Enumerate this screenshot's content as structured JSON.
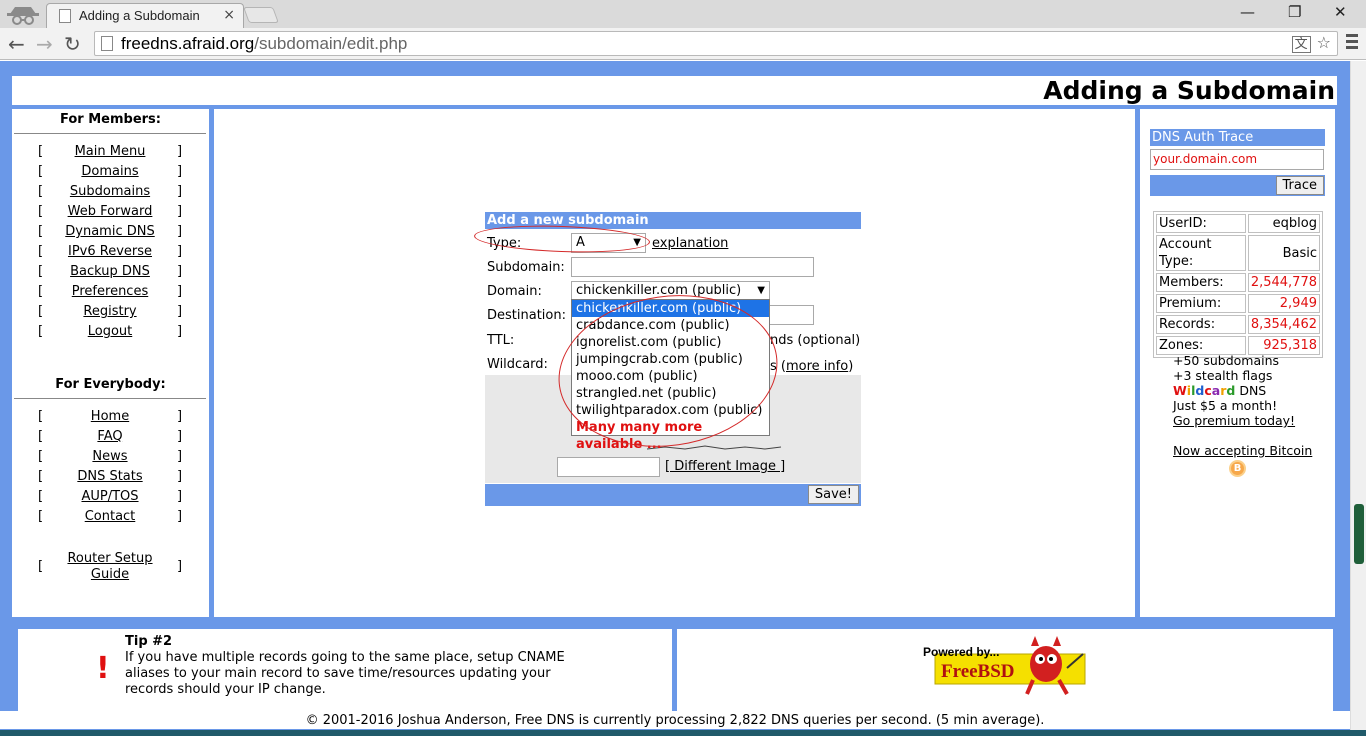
{
  "browser": {
    "tab_title": "Adding a Subdomain",
    "tab_close": "×",
    "url_host": "freedns.afraid.org",
    "url_path": "/subdomain/edit.php",
    "back": "←",
    "forward": "→",
    "reload": "↻",
    "minimize": "—",
    "restore": "❐",
    "close": "✕",
    "star": "☆",
    "translate": "文"
  },
  "page": {
    "title": "Adding a Subdomain"
  },
  "members": {
    "title": "For Members:",
    "items": [
      "Main Menu",
      "Domains",
      "Subdomains",
      "Web Forward",
      "Dynamic DNS",
      "IPv6 Reverse",
      "Backup DNS",
      "Preferences",
      "Registry",
      "Logout"
    ]
  },
  "everybody": {
    "title": "For Everybody:",
    "items": [
      "Home",
      "FAQ",
      "News",
      "DNS Stats",
      "AUP/TOS",
      "Contact"
    ],
    "router_line1": "Router Setup",
    "router_line2": "Guide"
  },
  "brackets": {
    "left": "[",
    "right": "]"
  },
  "form": {
    "heading": "Add a new subdomain",
    "type_label": "Type:",
    "type_value": "A",
    "explanation": "explanation",
    "subdomain_label": "Subdomain:",
    "domain_label": "Domain:",
    "domain_value": "chickenkiller.com (public)",
    "destination_label": "Destination:",
    "ttl_label": "TTL:",
    "ttl_suffix": "nds (optional)",
    "wildcard_label": "Wildcard:",
    "wildcard_suffix": "s (",
    "more_info": "more info",
    "more_info_close": ")",
    "different_image": "[ Different Image ]",
    "save": "Save!"
  },
  "domain_options": [
    "chickenkiller.com (public)",
    "crabdance.com (public)",
    "ignorelist.com (public)",
    "jumpingcrab.com (public)",
    "mooo.com (public)",
    "strangled.net (public)",
    "twilightparadox.com (public)",
    "Many many more available ..."
  ],
  "dns_trace": {
    "title": "DNS Auth Trace",
    "input_value": "your.domain.com",
    "button": "Trace"
  },
  "stats": [
    {
      "label": "UserID:",
      "value": "eqblog",
      "red": false
    },
    {
      "label": "Account Type:",
      "value": "Basic",
      "red": false
    },
    {
      "label": "Members:",
      "value": "2,544,778",
      "red": true
    },
    {
      "label": "Premium:",
      "value": "2,949",
      "red": true
    },
    {
      "label": "Records:",
      "value": "8,354,462",
      "red": true
    },
    {
      "label": "Zones:",
      "value": "925,318",
      "red": true
    }
  ],
  "promo": {
    "line1": "+50 subdomains",
    "line2": "+3 stealth flags",
    "wild_rest": "DNS",
    "line4": "Just $5 a month!",
    "link": "Go premium today!",
    "bitcoin": "Now accepting Bitcoin",
    "bitcoin_symbol": "B"
  },
  "tip": {
    "title": "Tip #2",
    "text": "If you have multiple records going to the same place, setup CNAME aliases to your main record to save time/resources updating your records should your IP change.",
    "icon": "!"
  },
  "bsd": {
    "powered": "Powered by...",
    "name": "FreeBSD"
  },
  "copyright": "© 2001-2016 Joshua Anderson, Free DNS is currently processing 2,822 DNS queries per second. (5 min average).",
  "colors": {
    "brand_blue": "#6a98e8",
    "link_red": "#e01010",
    "select_blue": "#1e73e6"
  }
}
